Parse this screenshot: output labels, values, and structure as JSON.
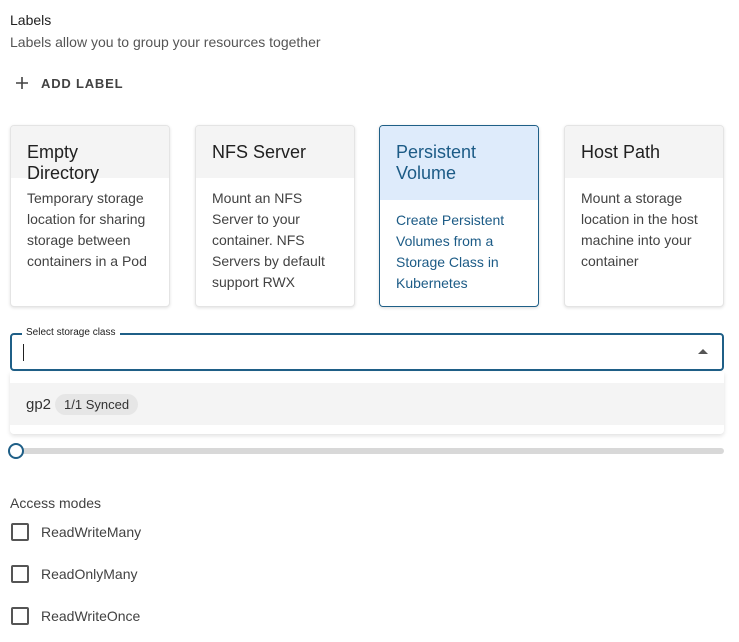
{
  "labels": {
    "title": "Labels",
    "description": "Labels allow you to group your resources together",
    "add_label": "ADD LABEL"
  },
  "volume_types": [
    {
      "title": "Empty Directory",
      "description": "Temporary storage location for sharing storage between containers in a Pod",
      "selected": false
    },
    {
      "title": "NFS Server",
      "description": "Mount an NFS Server to your container. NFS Servers by default support RWX",
      "selected": false
    },
    {
      "title": "Persistent Volume",
      "description": "Create Persistent Volumes from a Storage Class in Kubernetes",
      "selected": true
    },
    {
      "title": "Host Path",
      "description": "Mount a storage location in the host machine into your container",
      "selected": false
    }
  ],
  "storage_class": {
    "label": "Select storage class",
    "value": "",
    "options": [
      {
        "name": "gp2",
        "status": "1/1 Synced"
      }
    ]
  },
  "slider": {
    "value": 0
  },
  "access_modes": {
    "title": "Access modes",
    "items": [
      {
        "label": "ReadWriteMany",
        "checked": false
      },
      {
        "label": "ReadOnlyMany",
        "checked": false
      },
      {
        "label": "ReadWriteOnce",
        "checked": false
      }
    ]
  },
  "colors": {
    "accent": "#1f5f87",
    "selected_card_bg": "#deebfb"
  }
}
